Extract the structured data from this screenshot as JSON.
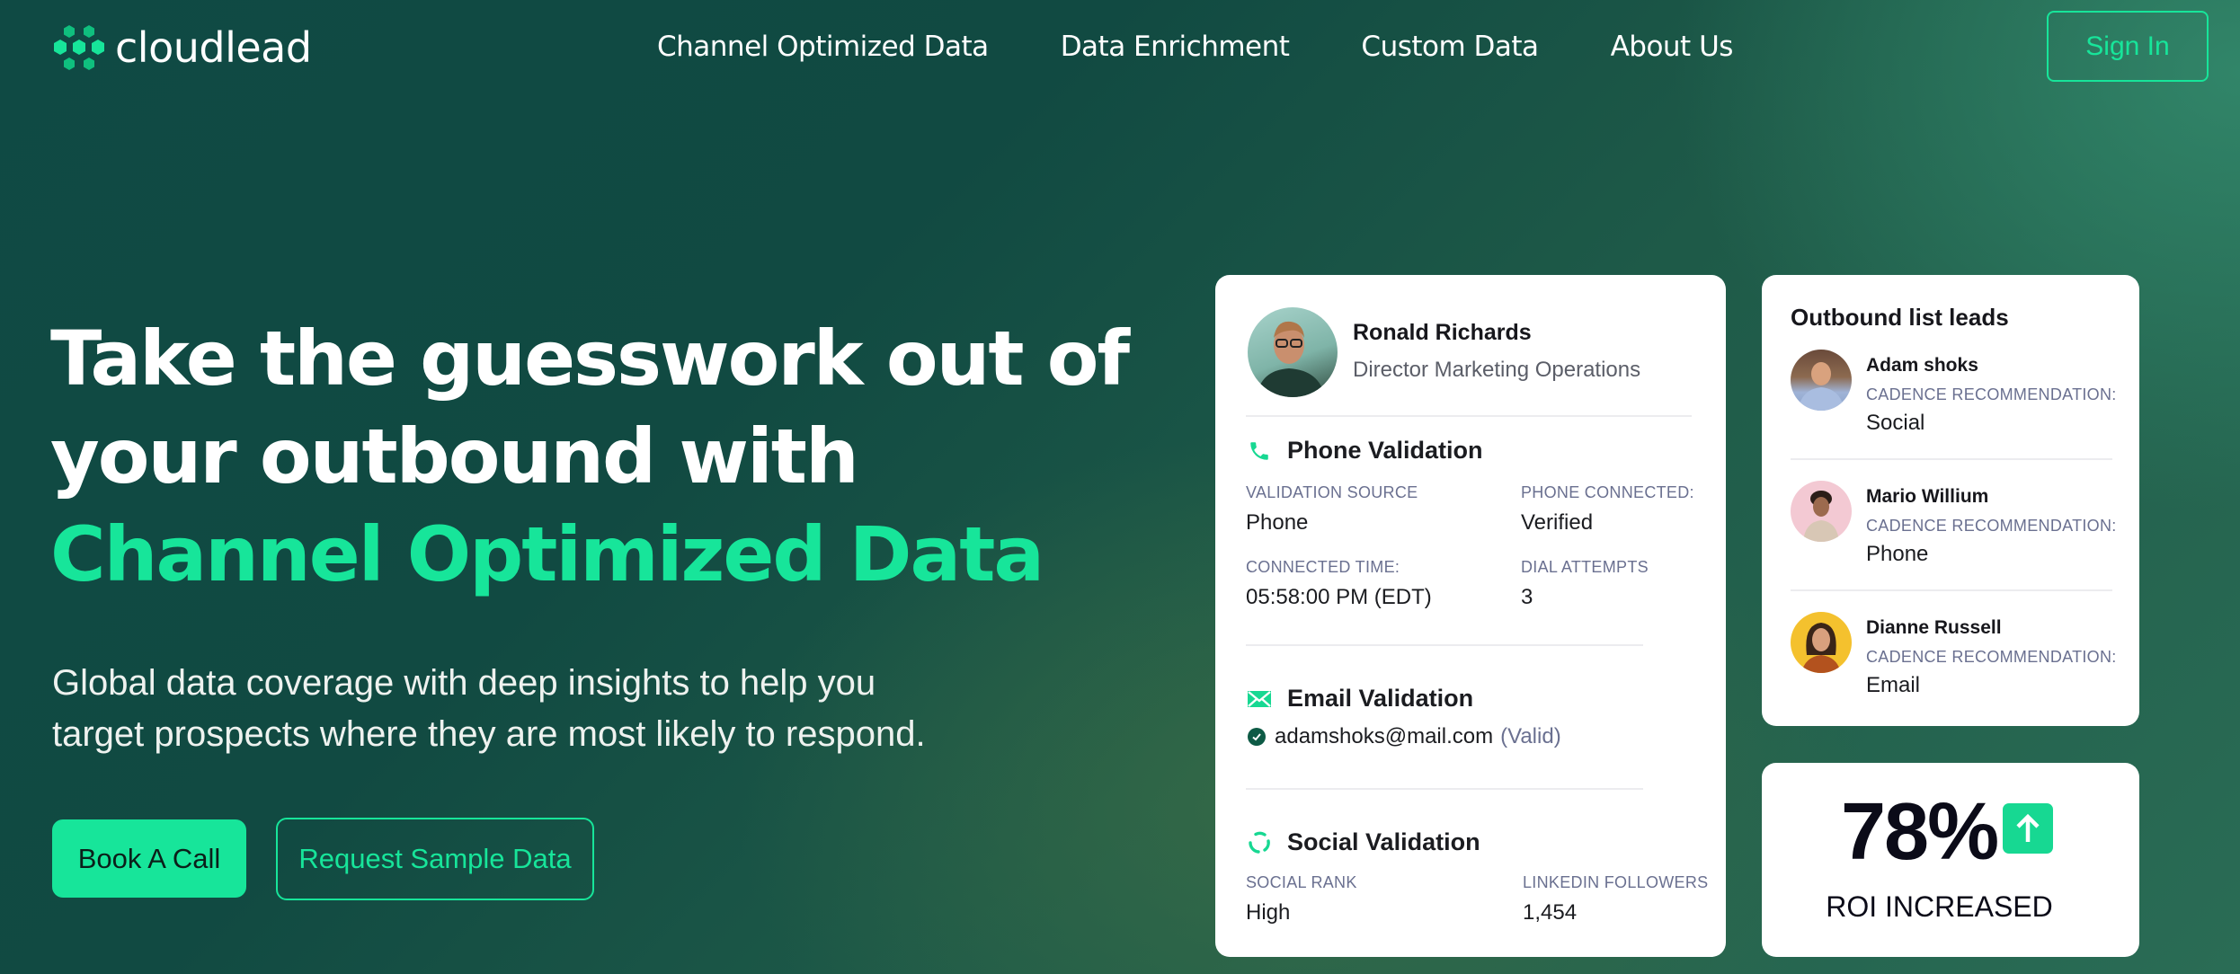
{
  "brand": {
    "name": "cloudlead",
    "logo_icon": "hexagon-cluster-icon",
    "accent": "#17e59a"
  },
  "nav": {
    "items": [
      {
        "label": "Channel Optimized Data"
      },
      {
        "label": "Data Enrichment"
      },
      {
        "label": "Custom Data"
      },
      {
        "label": "About Us"
      }
    ],
    "sign_in": "Sign In"
  },
  "hero": {
    "headline_line1": "Take the guesswork out of",
    "headline_line2": "your outbound with",
    "headline_accent": "Channel Optimized Data",
    "subtitle_line1": "Global data coverage with deep insights to help you",
    "subtitle_line2": "target prospects where they are most likely to respond.",
    "primary_cta": "Book A Call",
    "secondary_cta": "Request Sample Data"
  },
  "profile_card": {
    "name": "Ronald Richards",
    "title": "Director Marketing Operations",
    "phone": {
      "title": "Phone Validation",
      "icon": "phone-icon",
      "fields": [
        {
          "label": "VALIDATION SOURCE",
          "value": "Phone"
        },
        {
          "label": "PHONE CONNECTED:",
          "value": "Verified"
        },
        {
          "label": "CONNECTED TIME:",
          "value": "05:58:00 PM (EDT)"
        },
        {
          "label": "DIAL ATTEMPTS",
          "value": "3"
        }
      ]
    },
    "email": {
      "title": "Email Validation",
      "icon": "envelope-icon",
      "address": "adamshoks@mail.com",
      "status": "(Valid)"
    },
    "social": {
      "title": "Social Validation",
      "icon": "cycle-arrows-icon",
      "fields": [
        {
          "label": "SOCIAL RANK",
          "value": "High"
        },
        {
          "label": "LINKEDIN FOLLOWERS",
          "value": "1,454"
        }
      ]
    }
  },
  "leads_card": {
    "title": "Outbound list leads",
    "leads": [
      {
        "name": "Adam shoks",
        "label": "CADENCE RECOMMENDATION:",
        "value": "Social"
      },
      {
        "name": "Mario Willium",
        "label": "CADENCE RECOMMENDATION:",
        "value": "Phone"
      },
      {
        "name": "Dianne Russell",
        "label": "CADENCE RECOMMENDATION:",
        "value": "Email"
      }
    ]
  },
  "roi_card": {
    "value": "78%",
    "label": "ROI INCREASED",
    "trend_icon": "arrow-up-icon"
  }
}
